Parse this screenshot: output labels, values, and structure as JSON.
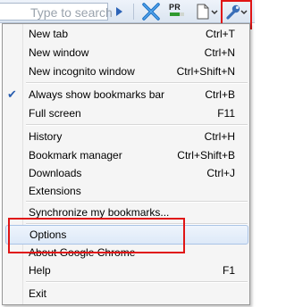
{
  "toolbar": {
    "search_placeholder": "Type to search",
    "pr_label": "PR",
    "icons": [
      "go-arrow-icon",
      "bookmark-x-icon",
      "pagerank-icon",
      "page-icon",
      "wrench-icon"
    ]
  },
  "menu": {
    "items": [
      {
        "label": "New tab",
        "shortcut": "Ctrl+T"
      },
      {
        "label": "New window",
        "shortcut": "Ctrl+N"
      },
      {
        "label": "New incognito window",
        "shortcut": "Ctrl+Shift+N"
      },
      {
        "label": "Always show bookmarks bar",
        "shortcut": "Ctrl+B",
        "checked": true
      },
      {
        "label": "Full screen",
        "shortcut": "F11"
      },
      {
        "label": "History",
        "shortcut": "Ctrl+H"
      },
      {
        "label": "Bookmark manager",
        "shortcut": "Ctrl+Shift+B"
      },
      {
        "label": "Downloads",
        "shortcut": "Ctrl+J"
      },
      {
        "label": "Extensions",
        "shortcut": ""
      },
      {
        "label": "Synchronize my bookmarks...",
        "shortcut": ""
      },
      {
        "label": "Options",
        "shortcut": "",
        "highlighted": true
      },
      {
        "label": "About Google Chrome",
        "shortcut": ""
      },
      {
        "label": "Help",
        "shortcut": "F1"
      },
      {
        "label": "Exit",
        "shortcut": ""
      }
    ]
  },
  "colors": {
    "highlight_box": "#e01515",
    "hover_item": "#dde9f8",
    "check": "#2a5fb0"
  }
}
